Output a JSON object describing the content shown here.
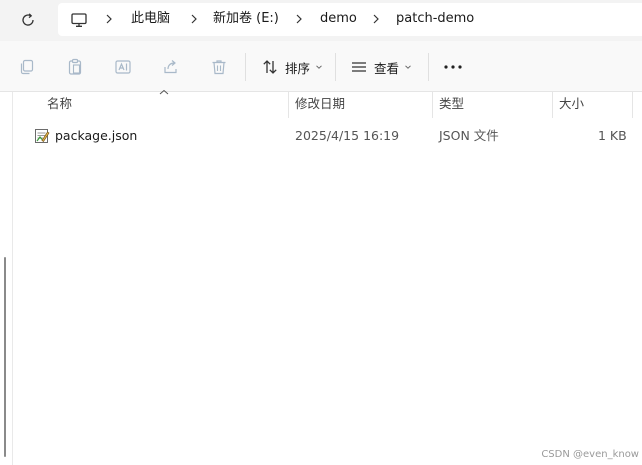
{
  "address_bar": {
    "breadcrumbs": [
      "此电脑",
      "新加卷 (E:)",
      "demo",
      "patch-demo"
    ]
  },
  "toolbar": {
    "sort_label": "排序",
    "view_label": "查看"
  },
  "file_list": {
    "columns": [
      "名称",
      "修改日期",
      "类型",
      "大小"
    ],
    "rows": [
      {
        "name": "package.json",
        "modified": "2025/4/15 16:19",
        "type": "JSON 文件",
        "size": "1 KB"
      }
    ]
  },
  "watermark": "CSDN @even_know",
  "icons": {
    "refresh": "refresh-icon",
    "pc": "pc-icon",
    "copy": "copy-icon",
    "paste": "paste-icon",
    "rename": "rename-icon",
    "share": "share-icon",
    "delete": "delete-icon",
    "sort": "sort-icon",
    "view": "view-icon",
    "more": "more-icon",
    "file": "json-file-icon"
  },
  "colors": {
    "address_bg": "#f3f3f3",
    "toolbar_bg": "#f9f9f9",
    "icon_disabled": "#a9b9c9",
    "text": "#1a1a1a",
    "muted": "#444444"
  }
}
